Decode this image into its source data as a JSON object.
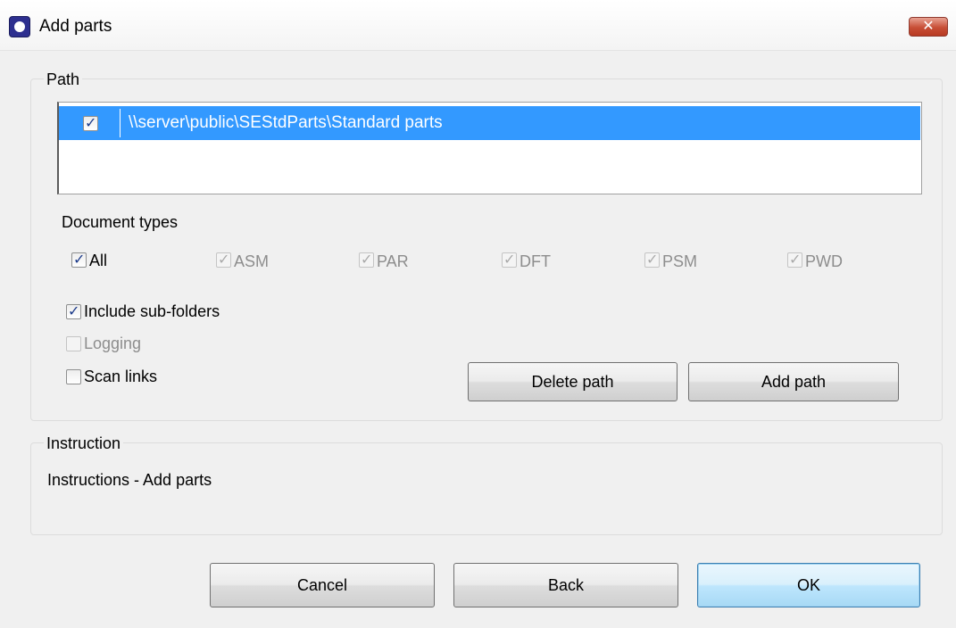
{
  "window": {
    "title": "Add parts",
    "close_glyph": "✕"
  },
  "path_group": {
    "legend": "Path",
    "paths": [
      {
        "checked": true,
        "value": "\\\\server\\public\\SEStdParts\\Standard parts"
      }
    ]
  },
  "document_types": {
    "label": "Document types",
    "types": [
      {
        "label": "All",
        "checked": true,
        "enabled": true
      },
      {
        "label": "ASM",
        "checked": true,
        "enabled": false
      },
      {
        "label": "PAR",
        "checked": true,
        "enabled": false
      },
      {
        "label": "DFT",
        "checked": true,
        "enabled": false
      },
      {
        "label": "PSM",
        "checked": true,
        "enabled": false
      },
      {
        "label": "PWD",
        "checked": true,
        "enabled": false
      }
    ]
  },
  "options": {
    "include_subfolders": {
      "label": "Include sub-folders",
      "checked": true,
      "enabled": true
    },
    "logging": {
      "label": "Logging",
      "checked": false,
      "enabled": false
    },
    "scan_links": {
      "label": "Scan links",
      "checked": false,
      "enabled": true
    }
  },
  "path_buttons": {
    "delete_label": "Delete path",
    "add_label": "Add path"
  },
  "instruction_group": {
    "legend": "Instruction",
    "text": "Instructions - Add parts"
  },
  "footer": {
    "cancel_label": "Cancel",
    "back_label": "Back",
    "ok_label": "OK"
  },
  "icons": {
    "app": "solid-edge-app-icon",
    "close": "close-icon",
    "checkbox": "checkbox"
  }
}
